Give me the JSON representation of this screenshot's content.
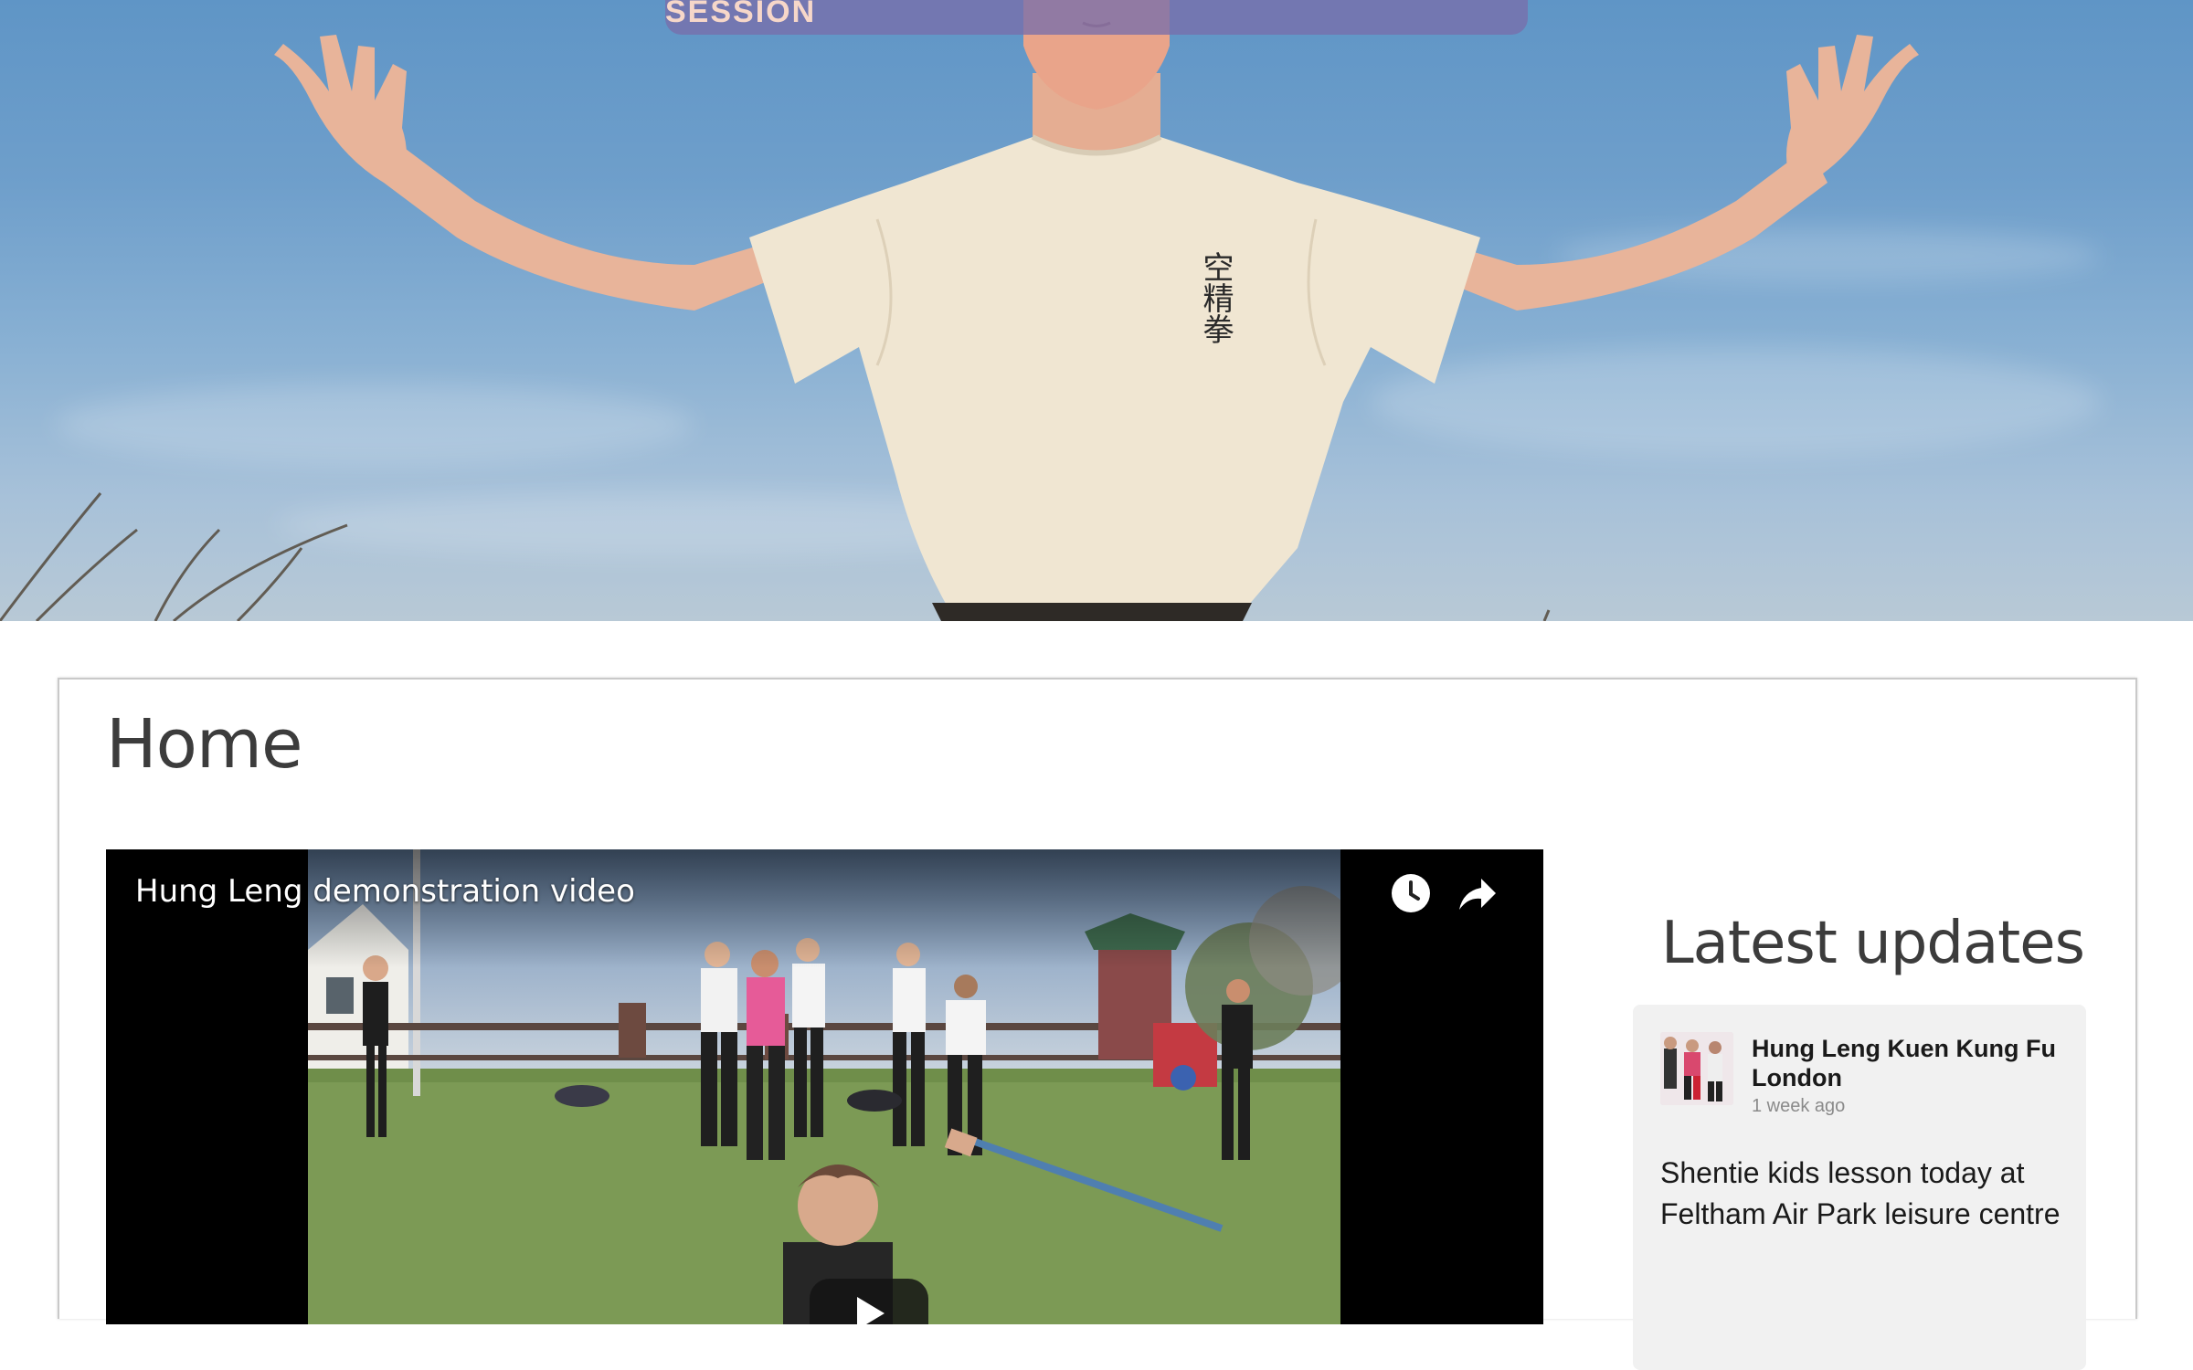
{
  "hero": {
    "cta_label": "START TRAINING WITH YOUR FREE TASTER SESSION",
    "shirt_characters": "空精拳"
  },
  "main": {
    "page_title": "Home",
    "video": {
      "title": "Hung Leng demonstration video",
      "icons": [
        "watch-later-icon",
        "share-icon",
        "play-icon"
      ]
    }
  },
  "sidebar": {
    "heading": "Latest updates",
    "update": {
      "source": "Hung Leng Kuen Kung Fu London",
      "time": "1 week ago",
      "text": "Shentie kids lesson today at Feltham Air Park leisure centre"
    }
  },
  "colors": {
    "sky": "#6f9fcb",
    "banner": "#786eaa",
    "heading_text": "#3c3c3c",
    "card_bg": "#f1f1f1"
  }
}
